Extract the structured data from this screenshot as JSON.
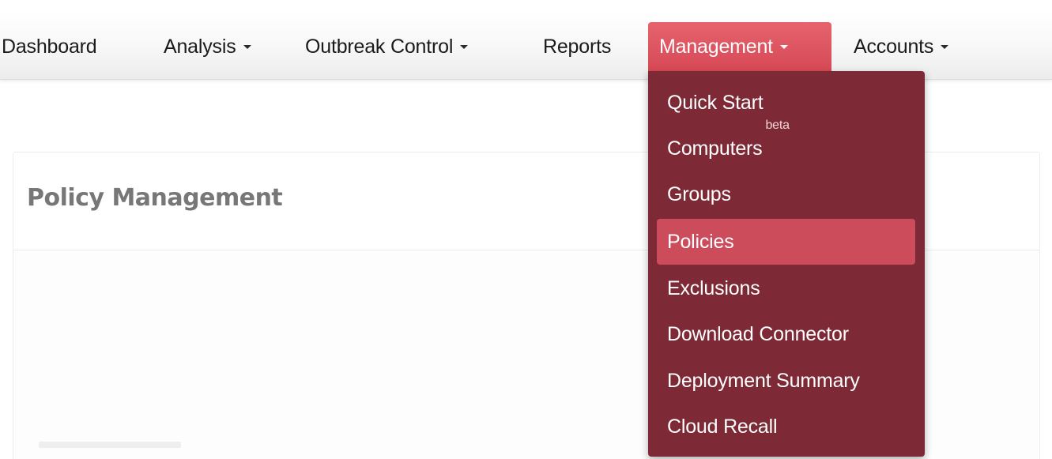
{
  "nav": {
    "dashboard": "Dashboard",
    "analysis": "Analysis",
    "outbreak_control": "Outbreak Control",
    "reports": "Reports",
    "management": "Management",
    "accounts": "Accounts"
  },
  "menu": {
    "items": [
      {
        "label": "Quick Start"
      },
      {
        "label": "Computers",
        "badge": "beta"
      },
      {
        "label": "Groups"
      },
      {
        "label": "Policies"
      },
      {
        "label": "Exclusions"
      },
      {
        "label": "Download Connector"
      },
      {
        "label": "Deployment Summary"
      },
      {
        "label": "Cloud Recall"
      }
    ]
  },
  "page": {
    "title": "Policy Management"
  },
  "colors": {
    "active_tab": "#d64955",
    "dropdown_bg": "#7d2a36",
    "selected_item": "#cd4c5b",
    "title_text": "#777777"
  },
  "icons": {
    "dropdown_caret": "caret-down-icon"
  }
}
